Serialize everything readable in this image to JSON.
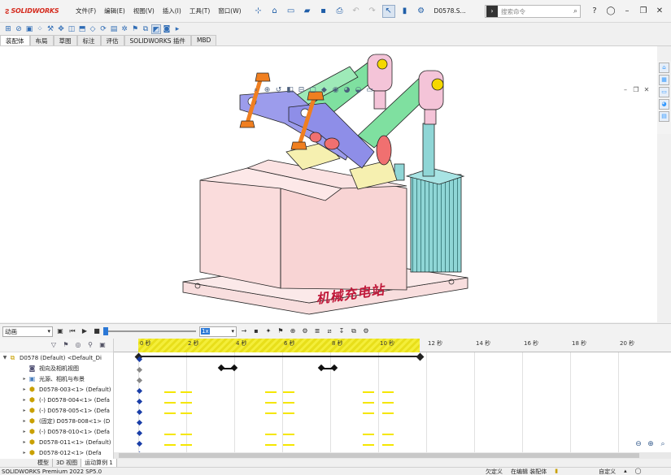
{
  "app": {
    "logo_mark": "3DS",
    "logo_text": "SOLIDWORKS",
    "menu": [
      "文件(F)",
      "编辑(E)",
      "视图(V)",
      "插入(I)",
      "工具(T)",
      "窗口(W)"
    ],
    "document_name": "D0578.S...",
    "search_placeholder": "搜索命令"
  },
  "command_tabs": [
    "装配体",
    "布局",
    "草图",
    "标注",
    "评估",
    "SOLIDWORKS 插件",
    "MBD"
  ],
  "active_tab_index": 0,
  "viewport": {
    "watermark": "机械充电站",
    "colors": {
      "base": "#f8dede",
      "arm": "#8e8ee8",
      "link": "#7fe0a0",
      "cylinder": "#8fd6d6",
      "bolt": "#f07f20",
      "clamp_pink": "#f4c4d8",
      "block": "#f6f0b0"
    }
  },
  "motion_manager": {
    "study_type": "动画",
    "speed": "1x",
    "time_ticks": [
      "0 秒",
      "2 秒",
      "4 秒",
      "6 秒",
      "8 秒",
      "10 秒",
      "12 秒",
      "14 秒",
      "16 秒",
      "18 秒",
      "20 秒"
    ],
    "tree": [
      {
        "label": "D0578 (Default) <Default_Di",
        "icon": "assembly-icon",
        "expander": "▼"
      },
      {
        "label": "视向及相机视图",
        "icon": "camera-icon",
        "expander": ""
      },
      {
        "label": "光源、相机与布景",
        "icon": "light-icon",
        "expander": "▸"
      },
      {
        "label": "D0578-003<1> (Default)",
        "icon": "part-icon",
        "expander": "▸"
      },
      {
        "label": "(-) D0578-004<1> (Defa",
        "icon": "part-icon",
        "expander": "▸"
      },
      {
        "label": "(-) D0578-005<1> (Defa",
        "icon": "part-icon",
        "expander": "▸"
      },
      {
        "label": "(固定) D0578-008<1> (D",
        "icon": "part-icon",
        "expander": "▸"
      },
      {
        "label": "(-) D0578-010<1> (Defa",
        "icon": "part-icon",
        "expander": "▸"
      },
      {
        "label": "D0578-011<1> (Default)",
        "icon": "part-icon",
        "expander": "▸"
      },
      {
        "label": "D0578-012<1> (Defa",
        "icon": "part-icon",
        "expander": "▸"
      }
    ]
  },
  "bottom_tabs": [
    "模型",
    "3D 视图",
    "运动算例 1"
  ],
  "active_bottom_tab": 2,
  "status": {
    "left": "SOLIDWORKS Premium 2022 SP5.0",
    "items": [
      "欠定义",
      "在编辑 装配体",
      "",
      "自定义"
    ]
  }
}
